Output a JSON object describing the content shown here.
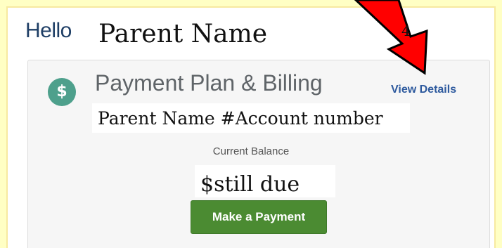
{
  "greeting": {
    "hello": "Hello",
    "parent_name": "Parent Name"
  },
  "card": {
    "icon": "dollar-icon",
    "icon_glyph": "$",
    "title": "Payment Plan & Billing",
    "view_details_label": "View Details",
    "account_text": "Parent Name #Account number",
    "balance_label": "Current Balance",
    "balance_value": "$still due",
    "pay_button_label": "Make a Payment"
  },
  "annotation": {
    "step_number": "4",
    "arrow_color": "#ff0000"
  },
  "colors": {
    "page_background": "#ffffc4",
    "accent_blue": "#2e5a9e",
    "icon_teal": "#4ea08c",
    "button_green": "#4b8b32"
  }
}
